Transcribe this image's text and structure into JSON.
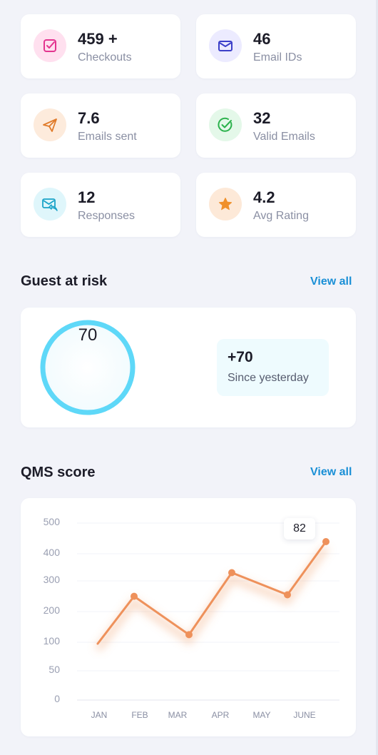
{
  "colors": {
    "background": "#f2f3f9",
    "card": "#ffffff",
    "accent_link": "#1a8fd6",
    "gauge_ring": "#5ed8f8",
    "line": "#ee915b"
  },
  "stats": [
    {
      "value": "459 +",
      "label": "Checkouts",
      "icon": "checkout-icon",
      "icon_color": "#e3348f",
      "icon_bg": "#ffe0ef"
    },
    {
      "value": "46",
      "label": "Email IDs",
      "icon": "mail-icon",
      "icon_color": "#3b3fc9",
      "icon_bg": "#ecebff"
    },
    {
      "value": "7.6",
      "label": "Emails sent",
      "icon": "send-icon",
      "icon_color": "#e07b2a",
      "icon_bg": "#fdebdc"
    },
    {
      "value": "32",
      "label": "Valid Emails",
      "icon": "check-circle-icon",
      "icon_color": "#2bb24c",
      "icon_bg": "#e4f8e9"
    },
    {
      "value": "12",
      "label": "Responses",
      "icon": "mail-reply-icon",
      "icon_color": "#1aa3c8",
      "icon_bg": "#dff6fb"
    },
    {
      "value": "4.2",
      "label": "Avg Rating",
      "icon": "star-icon",
      "icon_color": "#f0902a",
      "icon_bg": "#fde9d8"
    }
  ],
  "guest_risk": {
    "title": "Guest at risk",
    "view_all": "View all",
    "gauge_value": "70",
    "delta_value": "+70",
    "delta_label": "Since yesterday"
  },
  "qms": {
    "title": "QMS score",
    "view_all": "View all",
    "tooltip_value": "82"
  },
  "chart_data": {
    "type": "line",
    "title": "QMS score",
    "categories": [
      "JAN",
      "FEB",
      "MAR",
      "APR",
      "MAY",
      "JUNE"
    ],
    "x": [
      "JAN",
      "FEB",
      "MAR",
      "APR",
      "MAY",
      "JUNE"
    ],
    "yticks": [
      "500",
      "400",
      "300",
      "200",
      "100",
      "50",
      "0"
    ],
    "series": [
      {
        "values": [
          95,
          245,
          120,
          325,
          250,
          435
        ]
      }
    ],
    "ylim": [
      0,
      500
    ],
    "grid": true,
    "highlight_label": "82"
  }
}
